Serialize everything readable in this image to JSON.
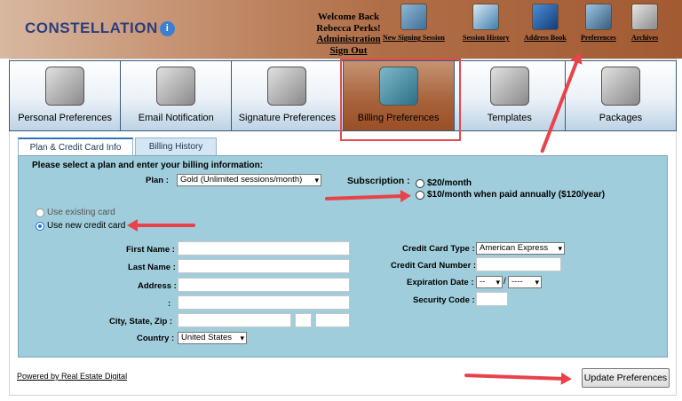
{
  "header": {
    "logo_text": "CONSTELLATION",
    "welcome_line1": "Welcome Back",
    "welcome_line2": "Rebecca Perks!",
    "admin_link": "Administration",
    "signout_link": "Sign Out",
    "icons": [
      {
        "label": "New Signing Session",
        "icon": "pencil-document-icon"
      },
      {
        "label": "Session History",
        "icon": "magnifier-document-icon"
      },
      {
        "label": "Address Book",
        "icon": "book-icon"
      },
      {
        "label": "Preferences",
        "icon": "settings-person-icon"
      },
      {
        "label": "Archives",
        "icon": "archive-box-icon"
      }
    ]
  },
  "tabs": [
    {
      "label": "Personal Preferences",
      "icon": "people-icon"
    },
    {
      "label": "Email Notification",
      "icon": "envelope-icon"
    },
    {
      "label": "Signature Preferences",
      "icon": "pen-icon"
    },
    {
      "label": "Billing Preferences",
      "icon": "calculator-icon",
      "active": true
    },
    {
      "label": "Templates",
      "icon": "documents-icon"
    },
    {
      "label": "Packages",
      "icon": "package-icon"
    }
  ],
  "subtabs": {
    "plan": "Plan & Credit Card Info",
    "history": "Billing History"
  },
  "form": {
    "prompt": "Please select a plan and enter your billing information:",
    "plan_label": "Plan :",
    "plan_value": "Gold (Unlimited sessions/month)",
    "subscription_label": "Subscription :",
    "sub_option1": "$20/month",
    "sub_option2": "$10/month when paid annually ($120/year)",
    "card_existing": "Use existing card",
    "card_new": "Use new credit card",
    "first_name": "First Name :",
    "last_name": "Last Name :",
    "address": "Address :",
    "address2": ":",
    "city_state_zip": "City, State, Zip :",
    "country": "Country :",
    "country_value": "United States",
    "cc_type": "Credit Card Type :",
    "cc_type_value": "American Express",
    "cc_number": "Credit Card Number :",
    "exp_date": "Expiration Date :",
    "exp_month": "--",
    "exp_sep": "/",
    "exp_year": "----",
    "security_code": "Security Code :"
  },
  "footer": {
    "powered_by": "Powered by Real Estate Digital",
    "update_button": "Update Preferences"
  },
  "colors": {
    "header_brown": "#a25a32",
    "panel_blue": "#9fcddb",
    "annotation_red": "#e8424b"
  }
}
